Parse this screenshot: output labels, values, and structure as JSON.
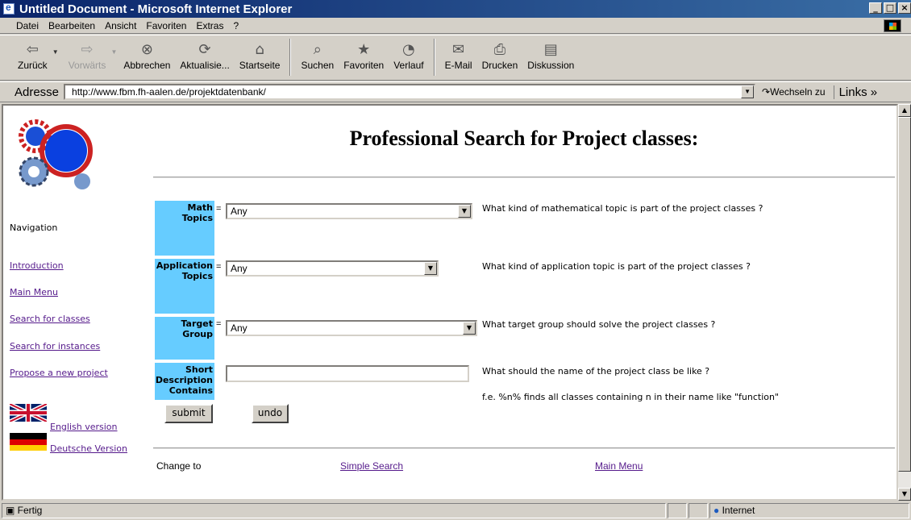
{
  "window": {
    "title": "Untitled Document - Microsoft Internet Explorer"
  },
  "menu": [
    "Datei",
    "Bearbeiten",
    "Ansicht",
    "Favoriten",
    "Extras",
    "?"
  ],
  "toolbar": {
    "back": "Zurück",
    "forward": "Vorwärts",
    "stop": "Abbrechen",
    "refresh": "Aktualisie...",
    "home": "Startseite",
    "search": "Suchen",
    "favorites": "Favoriten",
    "history": "Verlauf",
    "mail": "E-Mail",
    "print": "Drucken",
    "discuss": "Diskussion"
  },
  "address": {
    "label": "Adresse",
    "url": "http://www.fbm.fh-aalen.de/projektdatenbank/",
    "go": "Wechseln zu",
    "links": "Links »"
  },
  "page": {
    "title": "Professional Search for Project classes:",
    "nav_heading": "Navigation",
    "nav": [
      "Introduction",
      "Main Menu",
      "Search for classes",
      "Search for instances",
      "Propose a new project"
    ],
    "lang_en": "English version",
    "lang_de": "Deutsche Version",
    "rows": {
      "math": {
        "label": "Math Topics",
        "value": "Any",
        "help": "What kind of mathematical topic is part of the project classes ?"
      },
      "app": {
        "label": "Application Topics",
        "value": "Any",
        "help": "What kind of application topic is part of the project classes ?"
      },
      "target": {
        "label": "Target Group",
        "value": "Any",
        "help": "What target group should solve the project classes ?"
      },
      "short": {
        "label": "Short Description Contains",
        "help": "What should the name of the project class be like ?",
        "hint": "f.e. %n% finds all classes containing n in their name like \"function\""
      }
    },
    "eq": "=",
    "submit": "submit",
    "undo": "undo",
    "footer": {
      "change_to": "Change to",
      "simple_search": "Simple Search",
      "main_menu": "Main Menu"
    }
  },
  "status": {
    "text": "Fertig",
    "zone": "Internet"
  }
}
